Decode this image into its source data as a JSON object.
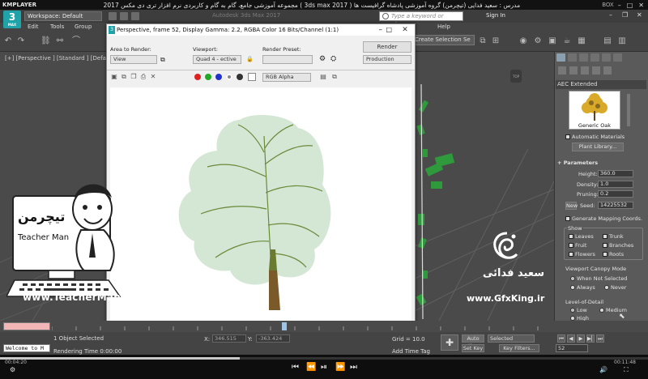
{
  "player": {
    "logo": "KMPLAYER",
    "title": "مجموعه آموزشی جامع، گام به گام و کاربردی نرم افزار تری دی مکس 2017 ( 3ds max 2017 ) مدرس : سعید فدایی (تیچرمن) گروه آموزشی پادشاه گرافیست ها",
    "box_label": "BOX",
    "time_elapsed": "00:04:20",
    "time_total": "00:11:48",
    "progress_fraction": 0.37,
    "controls": [
      "⏮",
      "⏪",
      "⏯",
      "⏩",
      "⏭"
    ]
  },
  "max": {
    "workspace": "Workspace: Default",
    "app_title": "Autodesk 3ds Max 2017",
    "search_placeholder": "Type a keyword or phrase",
    "sign_in": "Sign In",
    "menus": [
      "Edit",
      "Tools",
      "Group",
      "Help"
    ],
    "selection_set": "Create Selection Se",
    "viewport_label": "[+] [Perspective ] [Standard ] [Default Sh"
  },
  "render_window": {
    "title": "Perspective, frame 52, Display Gamma: 2.2, RGBA Color 16 Bits/Channel (1:1)",
    "area_to_render_label": "Area to Render:",
    "area_to_render_value": "View",
    "viewport_label": "Viewport:",
    "viewport_value": "Quad 4 - ective",
    "render_preset_label": "Render Preset:",
    "render_button": "Render",
    "production_value": "Production",
    "channel_value": "RGB Alpha"
  },
  "command_panel": {
    "category": "AEC Extended",
    "object_name": "Generic Oak",
    "automatic_materials": "Automatic Materials",
    "plant_library": "Plant Library...",
    "parameters_title": "Parameters",
    "height_label": "Height:",
    "height_value": "360.0",
    "density_label": "Density:",
    "density_value": "1.0",
    "pruning_label": "Pruning:",
    "pruning_value": "0.2",
    "new_button": "New",
    "seed_label": "Seed:",
    "seed_value": "14225532",
    "generate_mapping": "Generate Mapping Coords.",
    "show_label": "Show",
    "show_items": [
      "Leaves",
      "Trunk",
      "Fruit",
      "Branches",
      "Flowers",
      "Roots"
    ],
    "canopy_mode_label": "Viewport Canopy Mode",
    "canopy_options": [
      "When Not Selected",
      "Always",
      "Never"
    ],
    "lod_label": "Level-of-Detail",
    "lod_options": [
      "Low",
      "Medium",
      "High"
    ]
  },
  "status": {
    "objects_selected": "1 Object Selected",
    "rendering_time": "Rendering Time 0:00:00",
    "welcome": "Welcome to M",
    "x_label": "X:",
    "x_value": "346.515",
    "y_label": "Y:",
    "y_value": "-363.424",
    "grid": "Grid = 10.0",
    "add_time_tag": "Add Time Tag",
    "auto_key": "Auto Key",
    "selected": "Selected",
    "set_key": "Set Key",
    "key_filters": "Key Filters...",
    "frame": "52"
  },
  "branding": {
    "teacher_man_fa": "تیچرمن",
    "teacher_man_en": "Teacher Man",
    "website": "www.TeacherMan.ir",
    "name_fa": "سعید فدائی",
    "gfx_site": "www.GfxKing.ir"
  },
  "colors": {
    "accent": "#1fa3a9",
    "tree_canopy": "#cfe3cf",
    "branch": "#5a7a3a"
  }
}
